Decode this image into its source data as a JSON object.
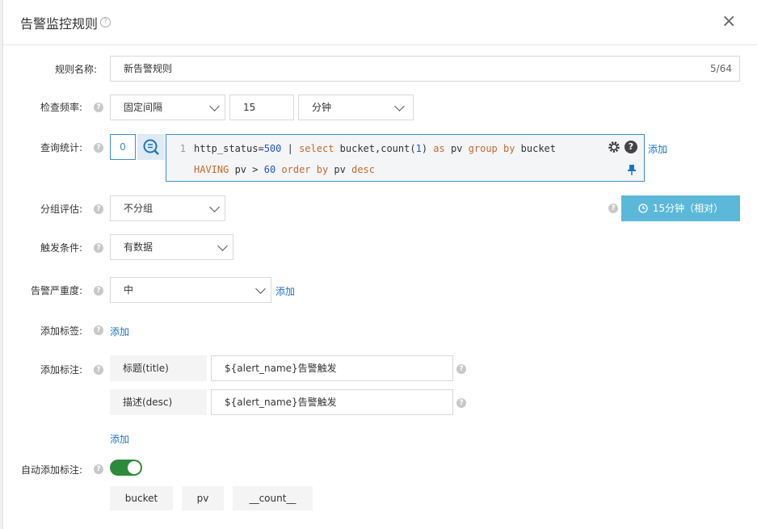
{
  "dialog": {
    "title": "告警监控规则",
    "close": "×"
  },
  "rule_name": {
    "label": "规则名称:",
    "value": "新告警规则",
    "counter": "5/64"
  },
  "check_freq": {
    "label": "检查频率:",
    "mode": "固定间隔",
    "interval": "15",
    "unit": "分钟"
  },
  "query": {
    "label": "查询统计:",
    "index": "0",
    "line_number": "1",
    "line1": {
      "a": "http_status=",
      "num500": "500",
      "b": " | ",
      "select": "select",
      "c": " bucket,count(",
      "num1": "1",
      "d": ") ",
      "as": "as",
      "e": " pv ",
      "groupby": "group by",
      "f": " bucket"
    },
    "line2": {
      "having": "HAVING",
      "a": " pv > ",
      "num60": "60",
      "b": " ",
      "orderby": "order by",
      "c": " pv ",
      "desc": "desc"
    },
    "add_link": "添加"
  },
  "group_eval": {
    "label": "分组评估:",
    "value": "不分组",
    "time_range": "15分钟（相对）"
  },
  "trigger": {
    "label": "触发条件:",
    "value": "有数据"
  },
  "severity": {
    "label": "告警严重度:",
    "value": "中",
    "add_link": "添加"
  },
  "labels": {
    "label": "添加标签:",
    "add_link": "添加"
  },
  "annotations": {
    "label": "添加标注:",
    "rows": [
      {
        "key": "标题(title)",
        "value": "${alert_name}告警触发"
      },
      {
        "key": "描述(desc)",
        "value": "${alert_name}告警触发"
      }
    ],
    "add_link": "添加"
  },
  "auto_annotations": {
    "label": "自动添加标注:",
    "enabled": true,
    "tags": [
      "bucket",
      "pv",
      "__count__"
    ]
  },
  "colors": {
    "accent": "#1a76c5",
    "time_button": "#5bb8d8",
    "toggle_on": "#2d8a3a"
  }
}
